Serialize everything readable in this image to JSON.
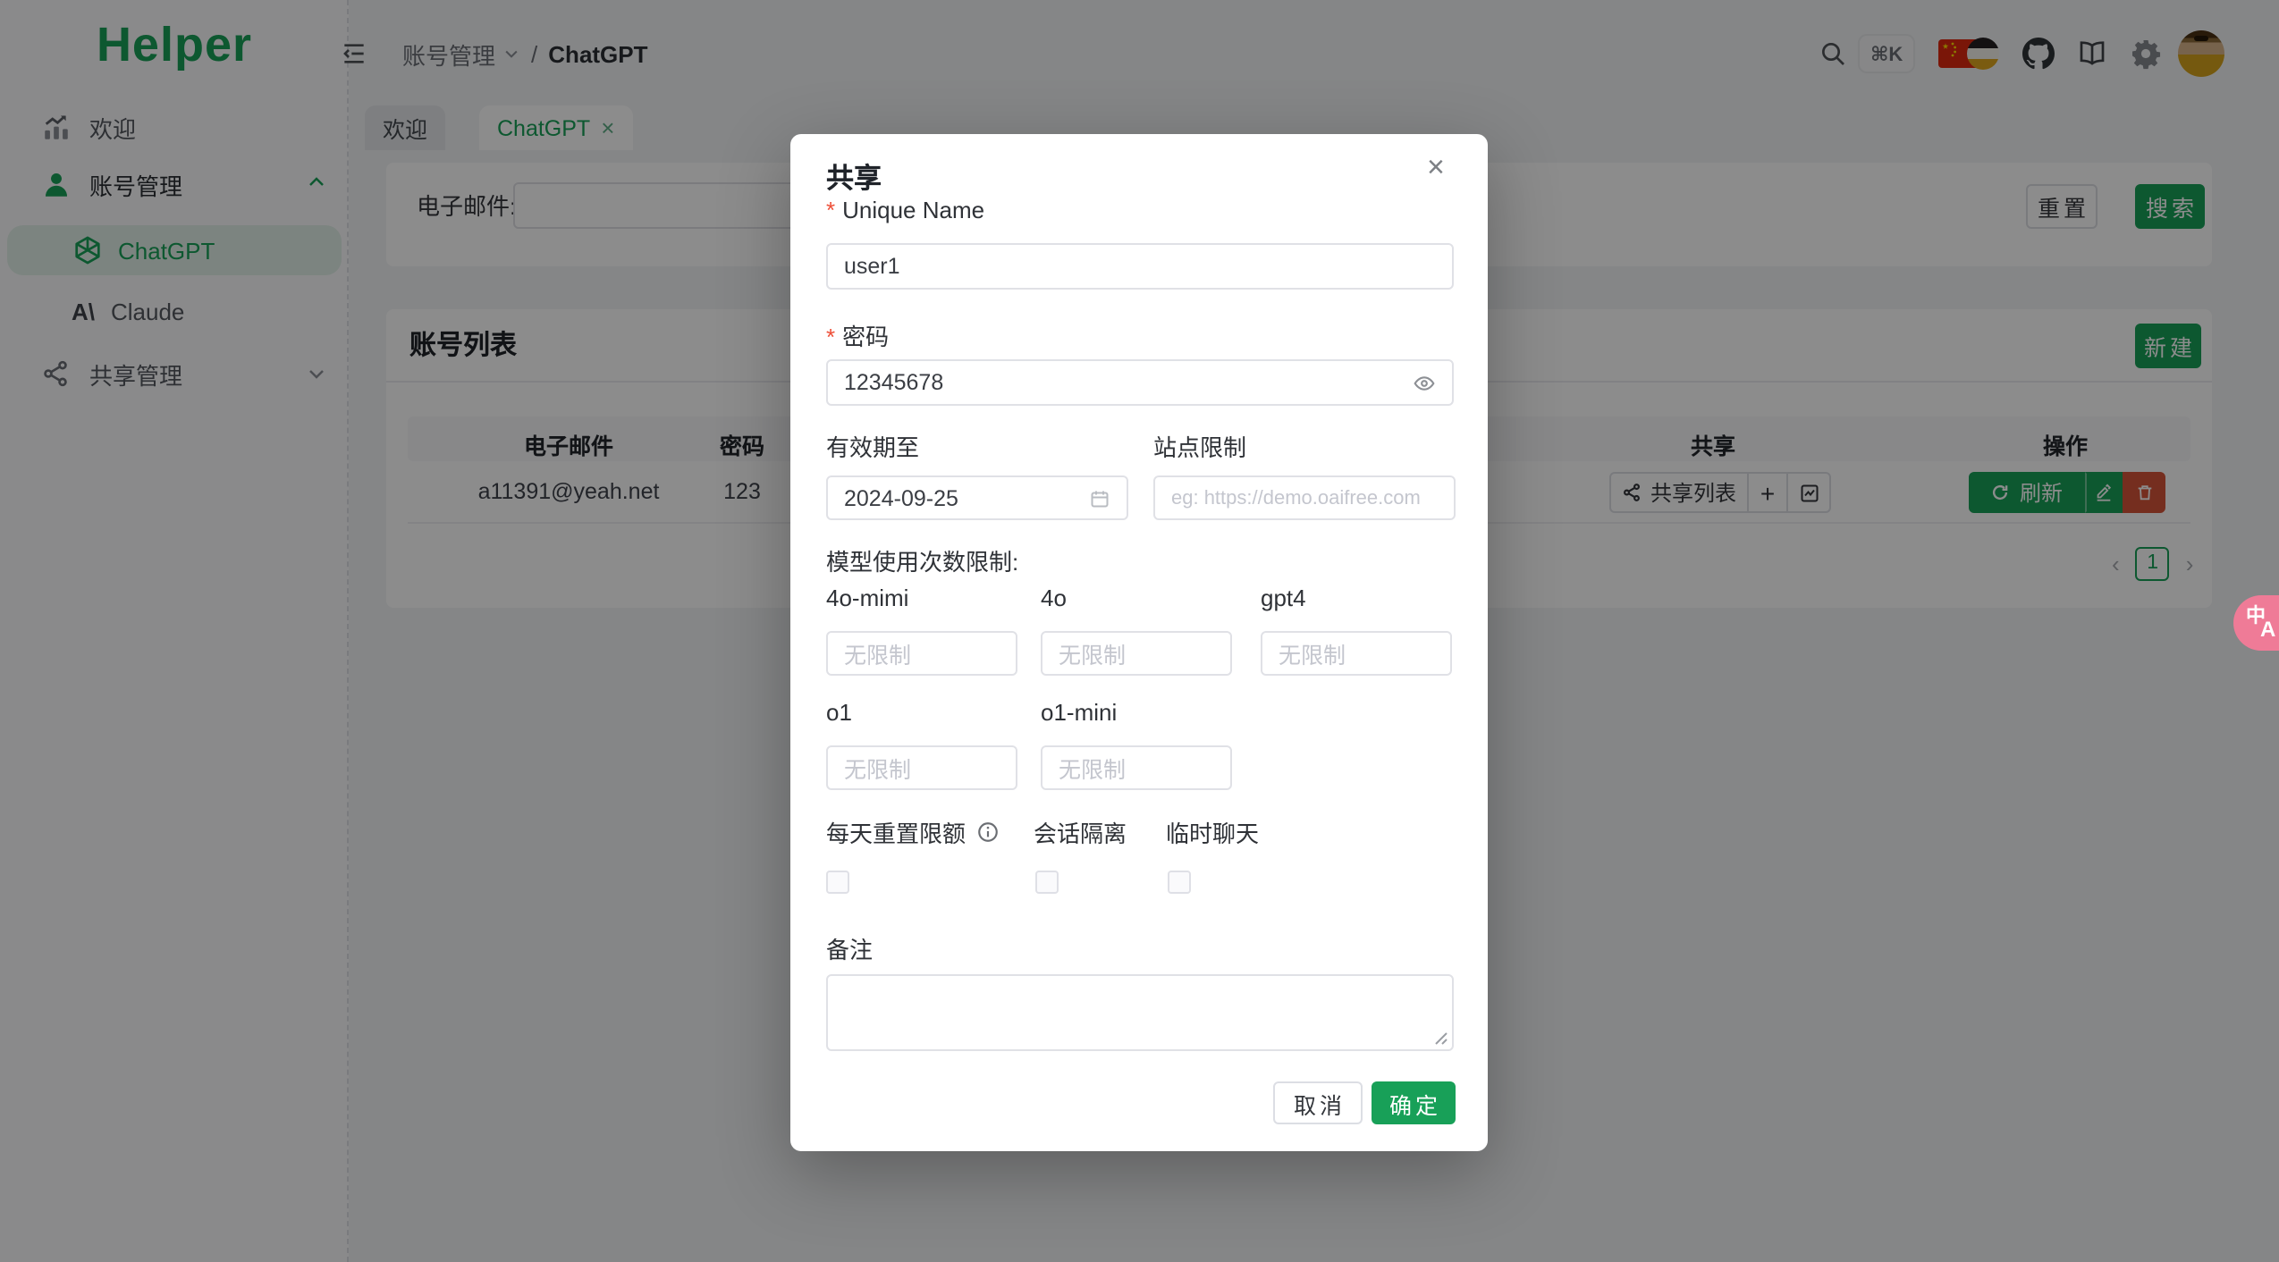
{
  "colors": {
    "primary": "#18a058",
    "primary_light": "#e2f1e9",
    "danger_red": "#d5543a",
    "pink_widget": "#ef7b97",
    "flag_red": "#de2910"
  },
  "app": {
    "logo": "Helper"
  },
  "sidebar": {
    "items": [
      {
        "label": "欢迎"
      },
      {
        "label": "账号管理"
      },
      {
        "label": "ChatGPT"
      },
      {
        "label": "Claude"
      },
      {
        "label": "共享管理"
      }
    ],
    "anthropic_glyph": "A\\"
  },
  "header": {
    "breadcrumb_root": "账号管理",
    "breadcrumb_sep": "/",
    "breadcrumb_current": "ChatGPT",
    "shortcut": "⌘K"
  },
  "tabs": {
    "welcome": "欢迎",
    "current": "ChatGPT",
    "close_glyph": "×"
  },
  "filter": {
    "email_label": "电子邮件:",
    "reset": "重置",
    "search": "搜索"
  },
  "account_list": {
    "title": "账号列表",
    "new_button": "新建",
    "headers": {
      "email": "电子邮件",
      "password": "密码",
      "share": "共享",
      "actions": "操作"
    },
    "row": {
      "email": "a11391@yeah.net",
      "password": "123",
      "share_list_button": "共享列表",
      "plus": "+",
      "refresh": "刷新"
    },
    "pagination": {
      "prev": "‹",
      "page": "1",
      "next": "›"
    }
  },
  "modal": {
    "title": "共享",
    "close_glyph": "×",
    "unique_name": {
      "label": "Unique Name",
      "value": "user1"
    },
    "password": {
      "label": "密码",
      "value": "12345678"
    },
    "expire": {
      "label": "有效期至",
      "value": "2024-09-25"
    },
    "site": {
      "label": "站点限制",
      "placeholder": "eg: https://demo.oaifree.com"
    },
    "model_limit_label": "模型使用次数限制:",
    "models": [
      {
        "name": "4o-mimi",
        "placeholder": "无限制"
      },
      {
        "name": "4o",
        "placeholder": "无限制"
      },
      {
        "name": "gpt4",
        "placeholder": "无限制"
      },
      {
        "name": "o1",
        "placeholder": "无限制"
      },
      {
        "name": "o1-mini",
        "placeholder": "无限制"
      }
    ],
    "checkboxes": [
      {
        "label": "每天重置限额"
      },
      {
        "label": "会话隔离"
      },
      {
        "label": "临时聊天"
      }
    ],
    "remark_label": "备注",
    "cancel": "取消",
    "confirm": "确定"
  },
  "translate_widget": {
    "glyph_cn": "中",
    "glyph_en": "A"
  }
}
